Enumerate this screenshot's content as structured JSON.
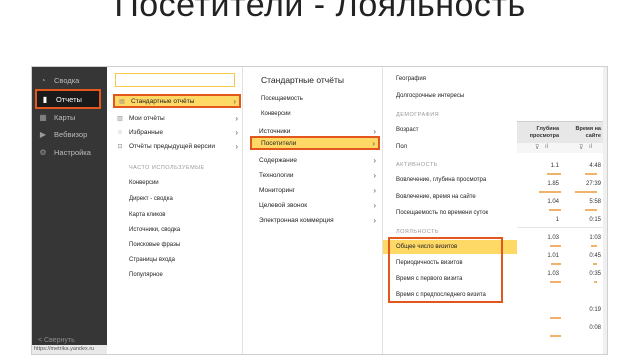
{
  "slide_title": "Посетители - Лояльность",
  "sidebar": {
    "items": [
      {
        "icon": "gauge-icon",
        "glyph": "◔",
        "label": "Сводка"
      },
      {
        "icon": "bar-chart-icon",
        "glyph": "▮",
        "label": "Отчеты"
      },
      {
        "icon": "map-icon",
        "glyph": "▦",
        "label": "Карты"
      },
      {
        "icon": "play-icon",
        "glyph": "▶",
        "label": "Вебвизор"
      },
      {
        "icon": "gear-icon",
        "glyph": "⚙",
        "label": "Настройка"
      }
    ],
    "collapse_label": "<  Свернуть",
    "url": "https://metrika.yandex.ru"
  },
  "col1": {
    "items": [
      {
        "label": "Стандартные отчёты",
        "glyph": "▤"
      },
      {
        "label": "Мои отчёты",
        "glyph": "▥"
      },
      {
        "label": "Избранные",
        "glyph": "☆"
      },
      {
        "label": "Отчёты предыдущей версии",
        "glyph": "⊡"
      }
    ],
    "frequent_header": "ЧАСТО ИСПОЛЬЗУЕМЫЕ",
    "frequent": [
      "Конверсии",
      "Директ - сводка",
      "Карта кликов",
      "Источники, сводка",
      "Поисковые фразы",
      "Страницы входа",
      "Популярное"
    ]
  },
  "col2": {
    "header": "Стандартные отчёты",
    "items": [
      "Посещаемость",
      "Конверсии",
      "Источники",
      "Посетители",
      "Содержание",
      "Технологии",
      "Мониторинг",
      "Целевой звонок",
      "Электронная коммерция"
    ]
  },
  "col3": {
    "top": [
      "География",
      "Долгосрочные интересы"
    ],
    "demography_header": "ДЕМОГРАФИЯ",
    "demography": [
      "Возраст",
      "Пол"
    ],
    "activity_header": "АКТИВНОСТЬ",
    "activity": [
      "Вовлечение, глубина просмотра",
      "Вовлечение, время на сайте",
      "Посещаемость по времени суток"
    ],
    "loyalty_header": "ЛОЯЛЬНОСТЬ",
    "loyalty": [
      "Общее число визитов",
      "Периодичность визитов",
      "Время с первого визита",
      "Время с предпоследнего визита"
    ]
  },
  "table": {
    "col1_header": "Глубина просмотра",
    "col2_header": "Время на сайте",
    "rows": [
      {
        "depth": "1.1",
        "time": "4:48"
      },
      {
        "depth": "1.85",
        "time": "27:39"
      },
      {
        "depth": "1.04",
        "time": "5:58"
      },
      {
        "depth": "1",
        "time": "0:15"
      },
      {
        "depth": "1.03",
        "time": "1:03"
      },
      {
        "depth": "1.01",
        "time": "0:45"
      },
      {
        "depth": "1.03",
        "time": "0:35"
      },
      {
        "depth": "",
        "time": "0:19"
      },
      {
        "depth": "",
        "time": "0:08"
      }
    ]
  },
  "colors": {
    "highlight": "#ffd966",
    "outline": "#e2571e",
    "sidebar": "#363636"
  }
}
